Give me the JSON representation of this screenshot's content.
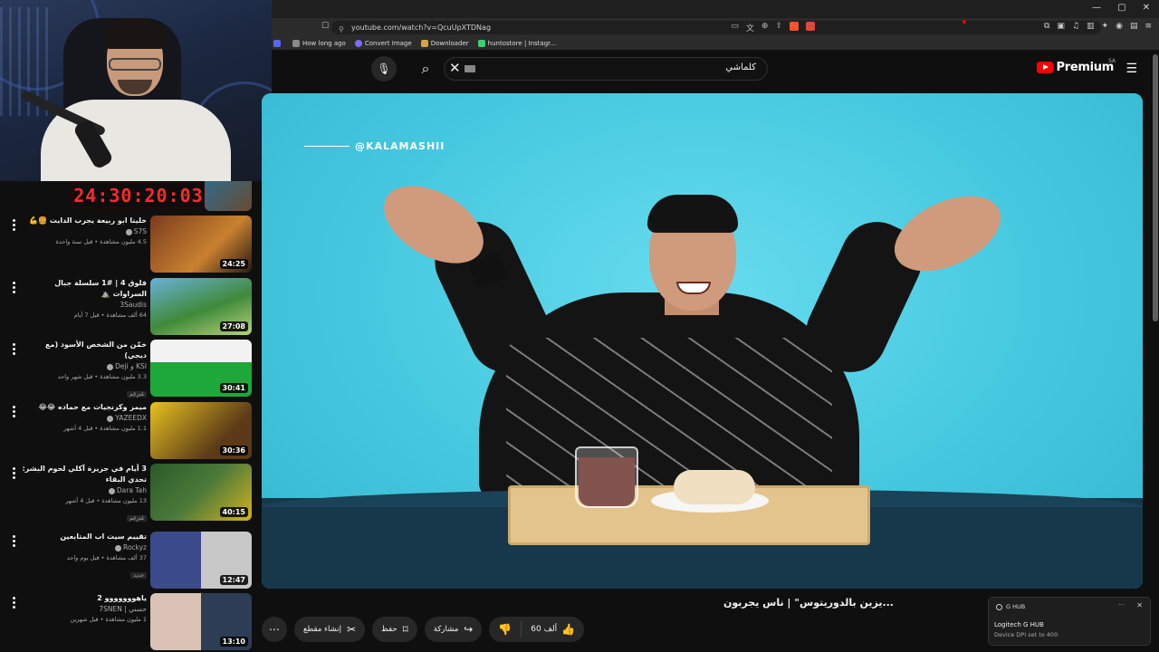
{
  "browser": {
    "url": "youtube.com/watch?v=QcuUpXTDNag",
    "window_controls": [
      "—",
      "▢",
      "✕"
    ],
    "bookmarks": [
      {
        "label": "",
        "icon": "s-icon",
        "color": "#5865f2"
      },
      {
        "label": "How long ago",
        "icon": "bookmark-icon",
        "color": "#8a8a8a"
      },
      {
        "label": "Convert Image",
        "icon": "convert-icon",
        "color": "#7c6cff"
      },
      {
        "label": "Downloader",
        "icon": "download-icon",
        "color": "#d9a441"
      },
      {
        "label": "huntostore | Instagr...",
        "icon": "instagram-icon",
        "color": "#3bd16f"
      }
    ]
  },
  "header": {
    "search_value": "كلماشي",
    "logo_text": "Premium",
    "country_code": "SA"
  },
  "timer": "24:30:20:03",
  "related": [
    {
      "title": "خلينا ابو ربيعة يجرب الدايت 🍔💪",
      "channel": "S7S",
      "verified": true,
      "meta": "4.5 مليون مشاهدة • قبل سنة واحدة",
      "duration": "24:25",
      "badge": "",
      "thumb_colors": [
        "#7a3b1e",
        "#c9812f"
      ]
    },
    {
      "title": "فلوق 4 | #1 سلسلة جبال السراوات ⛰️",
      "channel": "3Saudis",
      "verified": false,
      "meta": "64 ألف مشاهدة • قبل 7 أيام",
      "duration": "27:08",
      "badge": "",
      "thumb_colors": [
        "#3f8a3a",
        "#b8d27a"
      ]
    },
    {
      "title": "خمّن من الشخص الأسود (مع ديجي)",
      "channel": "KSI و Deji",
      "verified": true,
      "meta": "3.3 مليون مشاهدة • قبل شهر واحد",
      "duration": "30:41",
      "badge": "مُترجَم",
      "thumb_colors": [
        "#f2f2f2",
        "#1ea83a"
      ]
    },
    {
      "title": "ميمز وكرنجيات مع حماده 😂😂",
      "channel": "YAZEEDX",
      "verified": true,
      "meta": "1.1 مليون مشاهدة • قبل 4 أشهر",
      "duration": "30:36",
      "badge": "",
      "thumb_colors": [
        "#e7c21f",
        "#5b3a18"
      ]
    },
    {
      "title": "3 أيام في جزيرة آكلي لحوم البشر: تحدي البقاء",
      "channel": "Dara Tah",
      "verified": true,
      "meta": "13 مليون مشاهدة • قبل 4 أشهر",
      "duration": "40:15",
      "badge": "مُترجَم",
      "thumb_colors": [
        "#2b5a2a",
        "#d4b21f"
      ]
    },
    {
      "title": "تقييم سيت اب المتابعين",
      "channel": "Rockyz",
      "verified": true,
      "meta": "37 ألف مشاهدة • قبل يوم واحد",
      "duration": "12:47",
      "badge": "جديد",
      "thumb_colors": [
        "#3a4a8a",
        "#c7c7c7"
      ]
    },
    {
      "title": "ياهووووووو 2",
      "channel": "حسني | 7SNEN",
      "verified": false,
      "meta": "1 مليون مشاهدة • قبل شهرين",
      "duration": "13:10",
      "badge": "",
      "thumb_colors": [
        "#d9c2b3",
        "#2c3d55"
      ]
    }
  ],
  "player": {
    "watermark": "@KALAMASHII",
    "bg_color": "#4fd0e4"
  },
  "video": {
    "title": "...يزين بالدوريتوس\" | ناس يجربون",
    "likes": "60 ألف",
    "share_label": "مشاركة",
    "save_label": "حفظ",
    "clip_label": "إنشاء مقطع"
  },
  "toast": {
    "app": "G HUB",
    "title": "Logitech G HUB",
    "message": "Device DPI set to 400"
  }
}
